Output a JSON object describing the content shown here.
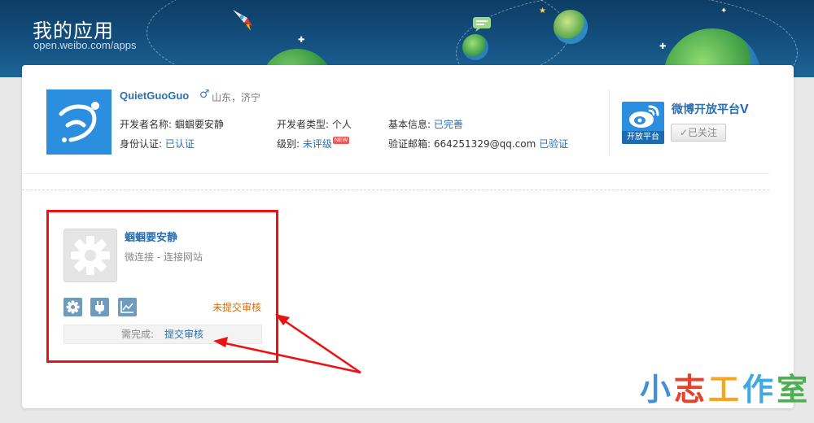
{
  "banner": {
    "title": "我的应用",
    "url": "open.weibo.com/apps"
  },
  "profile": {
    "username": "QuietGuoGuo",
    "gender_symbol": "♂",
    "location": "山东，济宁",
    "fields": {
      "dev_name_label": "开发者名称:",
      "dev_name_value": "蝈蝈要安静",
      "dev_type_label": "开发者类型:",
      "dev_type_value": "个人",
      "basic_info_label": "基本信息:",
      "basic_info_value": "已完善",
      "identity_label": "身份认证:",
      "identity_value": "已认证",
      "level_label": "级别:",
      "level_value": "未评级",
      "level_badge": "NEW",
      "email_label": "验证邮箱:",
      "email_value": "664251329@qq.com",
      "email_status": "已验证"
    }
  },
  "platform": {
    "logo_label": "开放平台",
    "name": "微博开放平台",
    "verified_mark": "V",
    "follow_label": "✓已关注"
  },
  "app": {
    "title": "蝈蝈要安静",
    "subtitle": "微连接 - 连接网站",
    "status": "未提交审核",
    "need_label": "需完成:",
    "need_link": "提交审核"
  },
  "watermark": {
    "chars": [
      "小",
      "志",
      "工",
      "作",
      "室"
    ],
    "colors": [
      "#3f8fd9",
      "#e8402a",
      "#f5a623",
      "#3fa9e0",
      "#4caf50"
    ]
  },
  "colors": {
    "accent_link": "#2a6fb0",
    "status_orange": "#e06a00",
    "highlight_red": "#e11"
  }
}
